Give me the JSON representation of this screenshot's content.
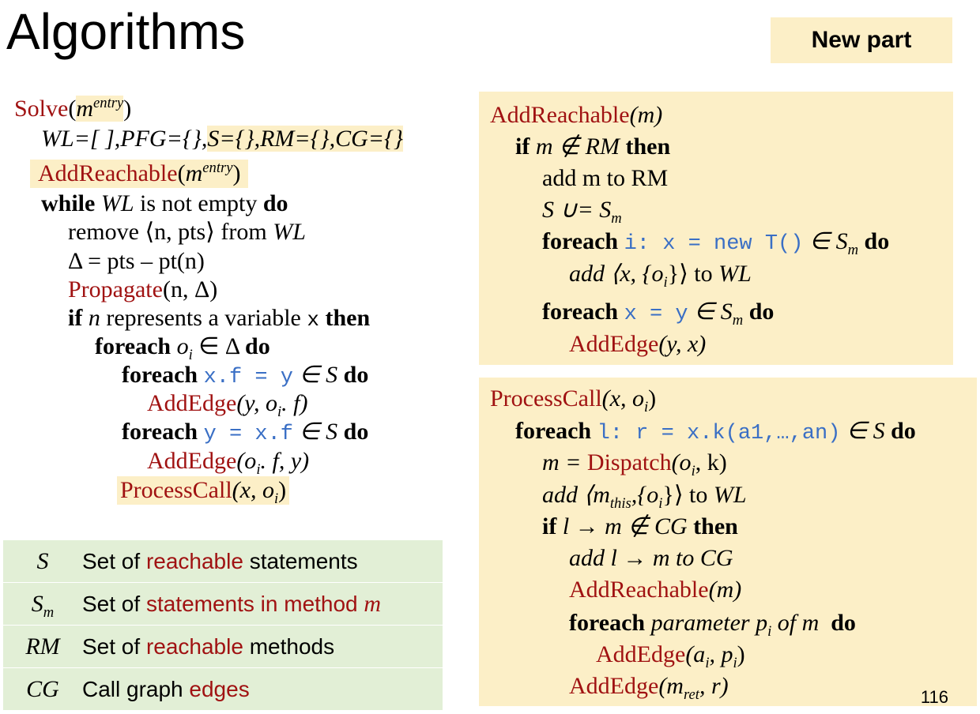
{
  "slide": {
    "title": "Algorithms",
    "badge": "New part",
    "page_number": "116"
  },
  "solve": {
    "name": "Solve",
    "param": "m",
    "param_sup": "entry",
    "init_a": "WL=[ ],PFG={},",
    "init_b": "S={},RM={},CG={}",
    "addreach": "AddReachable",
    "while_kw": "while",
    "while_var": "WL",
    "while_rest": "is not empty",
    "do_kw": "do",
    "remove_text": "remove ⟨n, pts⟩ from",
    "remove_var": "WL",
    "delta_line": "Δ = pts – pt(n)",
    "propagate": "Propagate",
    "propagate_args": "(n, Δ)",
    "if_kw": "if",
    "if_var": "n",
    "if_rest": "represents a variable",
    "if_x": "x",
    "then_kw": "then",
    "foreach_kw": "foreach",
    "foreach_oi": "o",
    "foreach_oi_sub": "i",
    "foreach_in_delta": "∈ Δ",
    "store_code": "x.f = y",
    "in_S": "∈ S",
    "addedge": "AddEdge",
    "addedge1_args_a": "(y, o",
    "addedge1_args_b": ". f)",
    "load_code": "y = x.f",
    "addedge2_args_a": "(o",
    "addedge2_args_b": ". f, y)",
    "processcall": "ProcessCall",
    "processcall_args_a": "(x, o",
    "processcall_args_b": ")"
  },
  "addreachable": {
    "name": "AddReachable",
    "args": "(m)",
    "if_line_kw": "if",
    "if_line_body": "m ∉ RM",
    "then_kw": "then",
    "add_line": "add m to RM",
    "union_a": "S ∪= S",
    "union_sub": "m",
    "foreach_kw": "foreach",
    "new_code": "i: x = new T()",
    "in_Sm": "∈ S",
    "sub_m": "m",
    "do_kw": "do",
    "add_wl_a": "add ⟨x, {o",
    "add_wl_sub": "i",
    "add_wl_b": "}⟩ to",
    "add_wl_var": "WL",
    "assign_code": "x = y",
    "addedge": "AddEdge",
    "addedge_args": "(y, x)"
  },
  "processcall": {
    "name": "ProcessCall",
    "args_a": "(x, o",
    "args_sub": "i",
    "args_b": ")",
    "foreach_kw": "foreach",
    "call_code": "l: r = x.k(a1,…,an)",
    "in_S": "∈ S",
    "do_kw": "do",
    "m_eq": "m = ",
    "dispatch": "Dispatch",
    "dispatch_args_a": "(o",
    "dispatch_args_b": ", k)",
    "add_this_a": "add ⟨m",
    "add_this_sub": "this",
    "add_this_b": ",{o",
    "add_this_c": "}⟩ to",
    "add_this_var": "WL",
    "if_kw": "if",
    "if_body": "l → m ∉ CG",
    "then_kw": "then",
    "add_cg": "add l → m to CG",
    "addreachable": "AddReachable",
    "addreachable_args": "(m)",
    "foreach_param_kw": "foreach",
    "foreach_param_rest_a": "parameter p",
    "foreach_param_sub": "i",
    "foreach_param_rest_b": " of m",
    "addedge": "AddEdge",
    "addedge_args_a": "(a",
    "addedge_args_b": ", p",
    "addedge_args_c": ")",
    "addedge_ret_a": "(m",
    "addedge_ret_sub": "ret",
    "addedge_ret_b": ", r)"
  },
  "legend": [
    {
      "symbol": "S",
      "symbol_sub": "",
      "desc_a": "Set of ",
      "desc_red": "reachable",
      "desc_b": " statements",
      "desc_red_extra": ""
    },
    {
      "symbol": "S",
      "symbol_sub": "m",
      "desc_a": "Set of ",
      "desc_red": "statements in method ",
      "desc_b": "",
      "desc_red_extra": "m"
    },
    {
      "symbol": "RM",
      "symbol_sub": "",
      "desc_a": "Set of ",
      "desc_red": "reachable",
      "desc_b": " methods",
      "desc_red_extra": ""
    },
    {
      "symbol": "CG",
      "symbol_sub": "",
      "desc_a": "Call graph ",
      "desc_red": "edges",
      "desc_b": "",
      "desc_red_extra": ""
    }
  ],
  "colors": {
    "keyword_red": "#a01212",
    "code_blue": "#3a6fc5",
    "panel_yellow": "#fcefc7",
    "legend_green": "#e2efd6"
  }
}
